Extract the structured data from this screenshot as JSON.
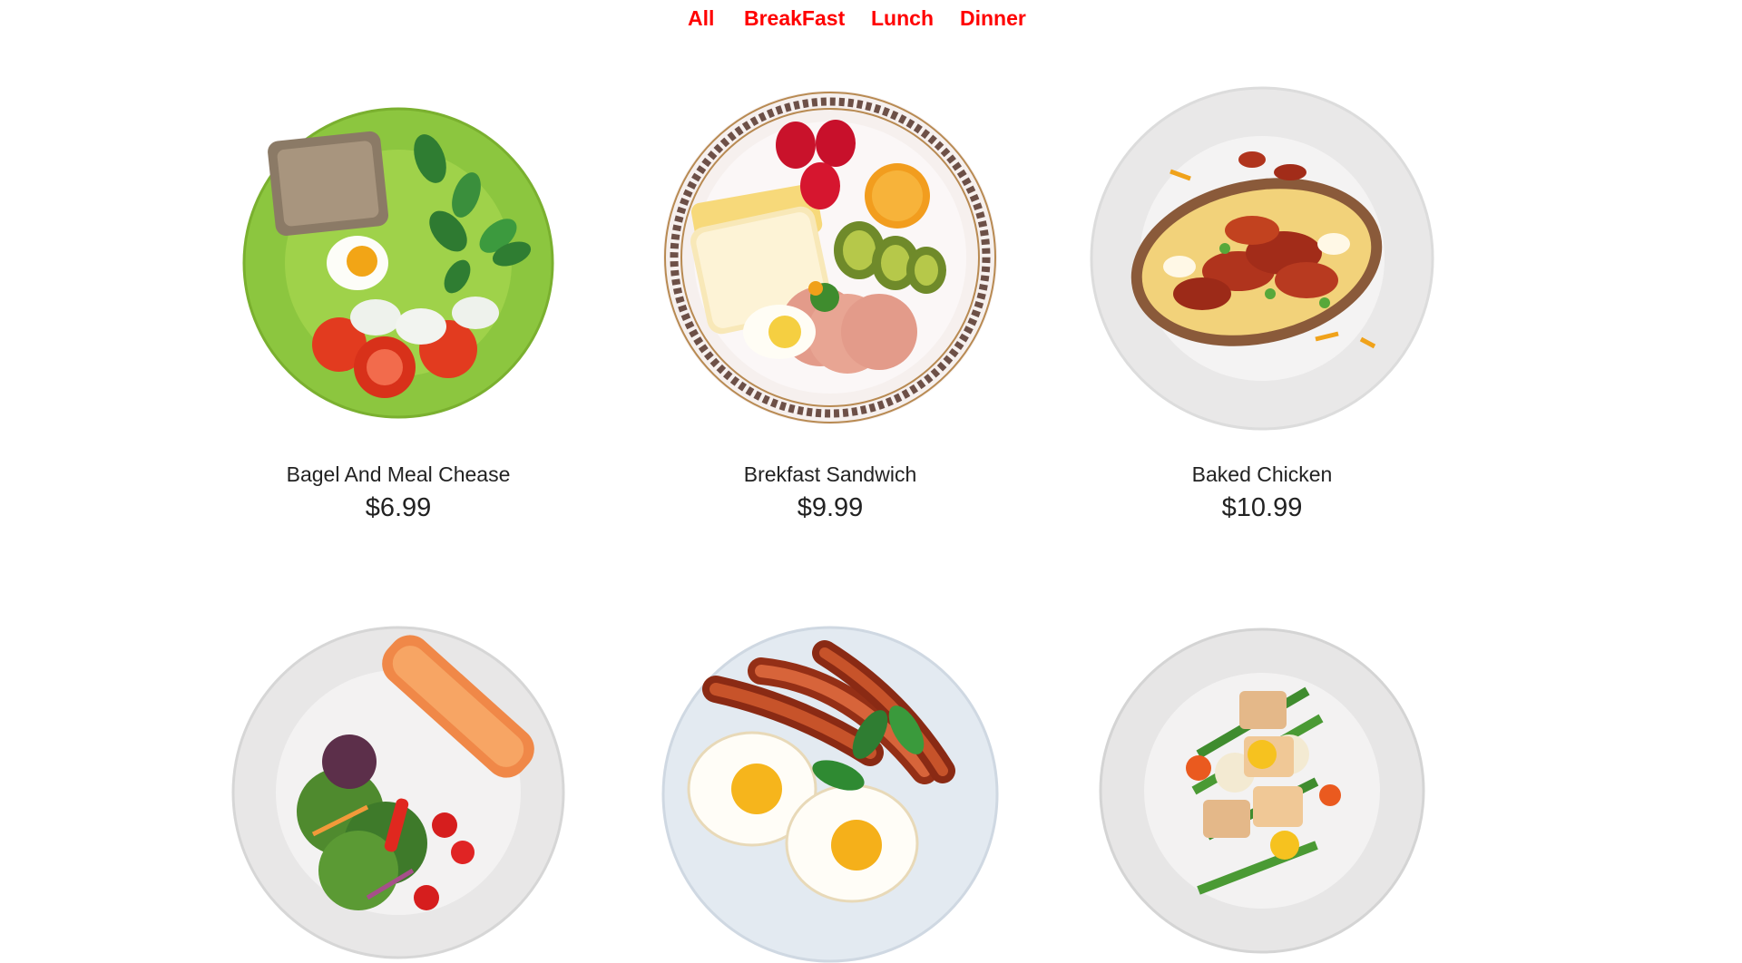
{
  "nav": {
    "items": [
      "All",
      "BreakFast",
      "Lunch",
      "Dinner"
    ],
    "color": "#ff0000"
  },
  "menu": {
    "items": [
      {
        "name": "Bagel And Meal Chease",
        "price": "$6.99",
        "image": "green-plate-bread-egg-tomato"
      },
      {
        "name": "Brekfast Sandwich",
        "price": "$9.99",
        "image": "patterned-plate-bread-fruit"
      },
      {
        "name": "Baked Chicken",
        "price": "$10.99",
        "image": "white-plate-baked-potato"
      },
      {
        "image": "white-plate-salmon-salad"
      },
      {
        "image": "white-plate-eggs-bacon"
      },
      {
        "image": "white-plate-chicken-salad"
      }
    ]
  }
}
